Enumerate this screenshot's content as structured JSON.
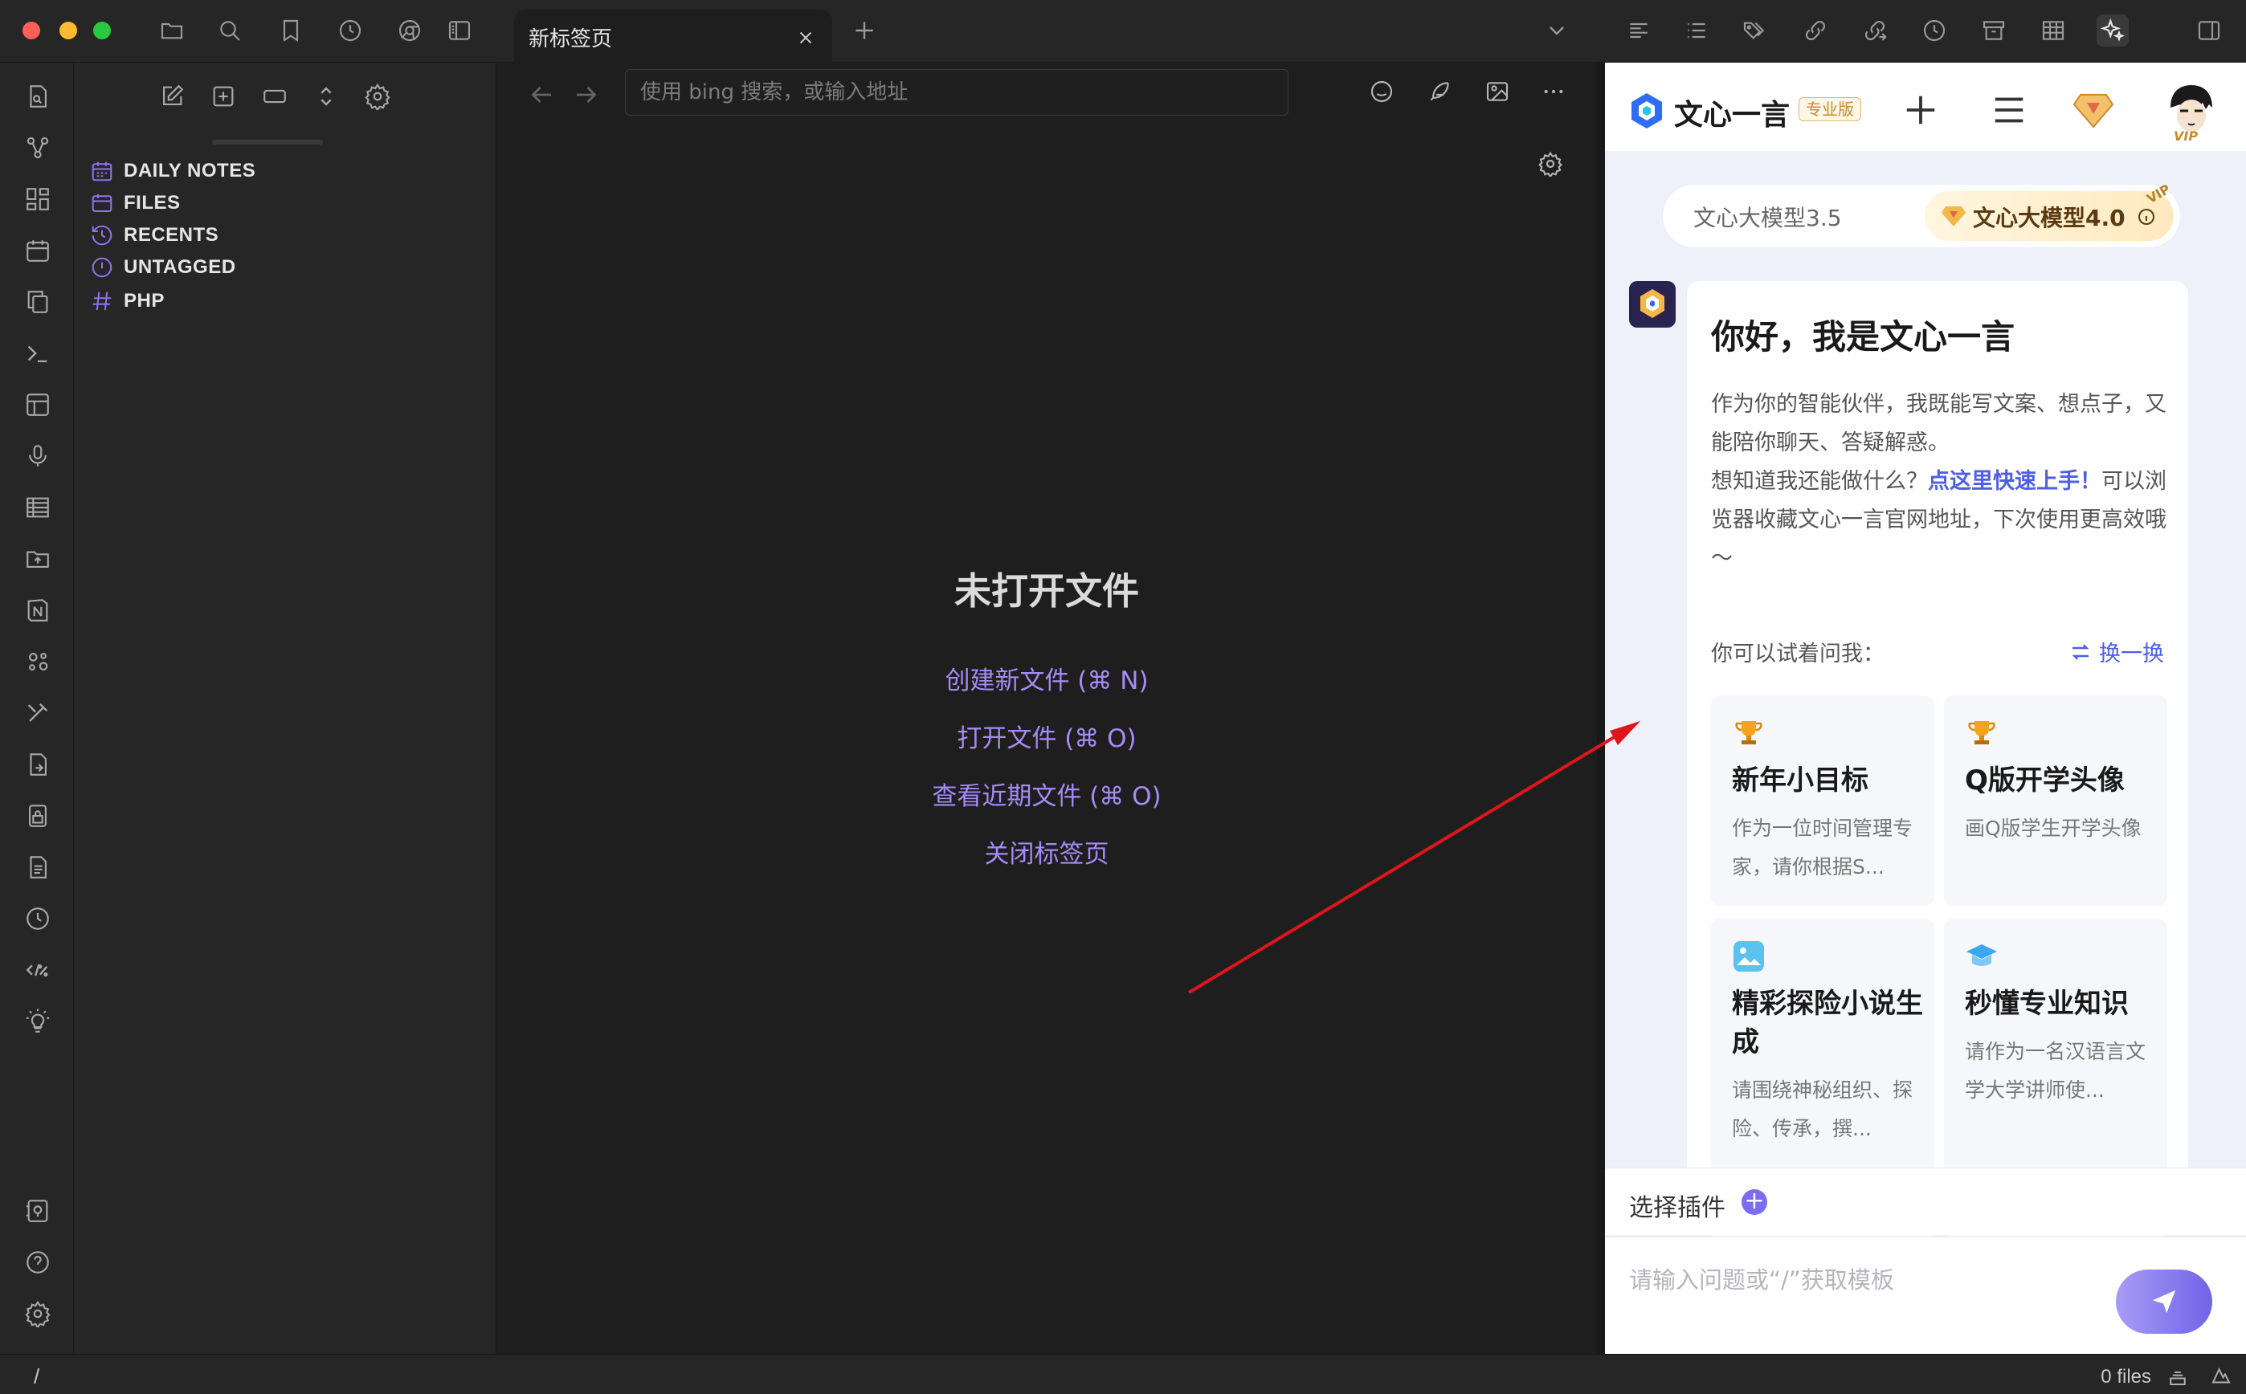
{
  "tab": {
    "title": "新标签页"
  },
  "browser": {
    "url_placeholder": "使用 bing 搜索，或输入地址"
  },
  "sidebar": {
    "items": [
      {
        "label": "DAILY NOTES",
        "icon": "calendar-icon"
      },
      {
        "label": "FILES",
        "icon": "folder-icon"
      },
      {
        "label": "RECENTS",
        "icon": "history-icon"
      },
      {
        "label": "UNTAGGED",
        "icon": "alert-circle-icon"
      },
      {
        "label": "PHP",
        "icon": "hash-icon"
      }
    ]
  },
  "empty_state": {
    "title": "未打开文件",
    "actions": [
      "创建新文件 (⌘ N)",
      "打开文件 (⌘ O)",
      "查看近期文件 (⌘ O)",
      "关闭标签页"
    ]
  },
  "yiyan": {
    "brand": "文心一言",
    "badge": "专业版",
    "avatar_tag": "VIP",
    "models": {
      "basic": "文心大模型3.5",
      "pro": "文心大模型4.0",
      "pro_tag": "VIP"
    },
    "greeting": "你好，我是文心一言",
    "intro_1": "作为你的智能伙伴，我既能写文案、想点子，又能陪你聊天、答疑解惑。",
    "intro_2_prefix": "想知道我还能做什么？",
    "intro_2_link": "点这里快速上手！",
    "intro_2_suffix": "可以浏览器收藏文心一言官网地址，下次使用更高效哦～",
    "try_label": "你可以试着问我：",
    "swap_label": "换一换",
    "suggestions": [
      {
        "title": "新年小目标",
        "desc": "作为一位时间管理专家，请你根据S...",
        "icon": "trophy-icon"
      },
      {
        "title": "Q版开学头像",
        "desc": "画Q版学生开学头像",
        "icon": "trophy-icon"
      },
      {
        "title": "精彩探险小说生成",
        "desc": "请围绕神秘组织、探险、传承，撰...",
        "icon": "image-icon"
      },
      {
        "title": "秒懂专业知识",
        "desc": "请作为一名汉语言文学大学讲师使...",
        "icon": "graduation-cap-icon"
      }
    ],
    "plugin_label": "选择插件",
    "input_placeholder": "请输入问题或“/”获取模板"
  },
  "status": {
    "path": "/",
    "files": "0 files"
  },
  "colors": {
    "accent_purple": "#8f72f0",
    "link_purple": "#a58bf6",
    "yiyan_blue": "#4e5ee8",
    "arrow_red": "#e0151b"
  }
}
